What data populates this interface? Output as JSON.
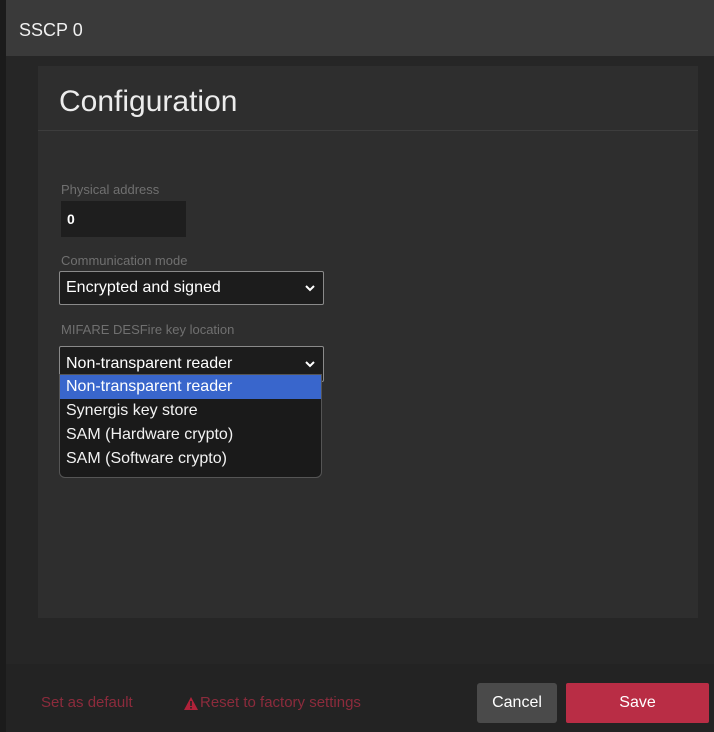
{
  "window": {
    "title": "SSCP 0"
  },
  "panel": {
    "title": "Configuration"
  },
  "physical_address": {
    "label": "Physical address",
    "value": "0"
  },
  "communication_mode": {
    "label": "Communication mode",
    "selected": "Encrypted and signed"
  },
  "key_location": {
    "label": "MIFARE DESFire key location",
    "selected": "Non-transparent reader",
    "options": [
      "Non-transparent reader",
      "Synergis key store",
      "SAM (Hardware crypto)",
      "SAM (Software crypto)"
    ]
  },
  "footer": {
    "set_default": "Set as default",
    "reset": "Reset to factory settings",
    "cancel": "Cancel",
    "save": "Save"
  },
  "colors": {
    "accent_save": "#b92d45",
    "link_red": "#8c2b3c",
    "highlight": "#3966cc"
  }
}
